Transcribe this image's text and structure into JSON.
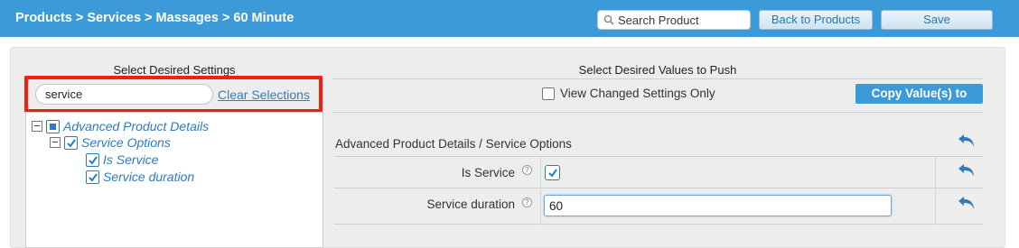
{
  "header": {
    "breadcrumb": "Products > Services > Massages > 60 Minute",
    "search_placeholder": "Search Product",
    "back_label": "Back to Products",
    "save_label": "Save"
  },
  "left_panel": {
    "title": "Select Desired Settings",
    "filter_value": "service",
    "clear_label": "Clear Selections",
    "tree": {
      "root": {
        "label": "Advanced Product Details",
        "state": "partial",
        "expander": "collapse"
      },
      "group": {
        "label": "Service Options",
        "state": "checked",
        "expander": "collapse"
      },
      "items": [
        {
          "label": "Is Service",
          "state": "checked"
        },
        {
          "label": "Service duration",
          "state": "checked"
        }
      ]
    }
  },
  "right_panel": {
    "title": "Select Desired Values to Push",
    "view_changed_label": "View Changed Settings Only",
    "view_changed_checked": false,
    "copy_label": "Copy Value(s) to",
    "group_header": "Advanced Product Details / Service Options",
    "fields": [
      {
        "label": "Is Service",
        "type": "checkbox",
        "checked": true
      },
      {
        "label": "Service duration",
        "type": "text",
        "value": "60"
      }
    ]
  },
  "icons": {
    "search": "search-icon",
    "help": "help-icon",
    "undo": "undo-arrow-icon"
  },
  "colors": {
    "header_bg": "#3d9ad9",
    "accent": "#2a7bc0",
    "link": "#2f7fc1",
    "highlight": "#f0210e"
  }
}
